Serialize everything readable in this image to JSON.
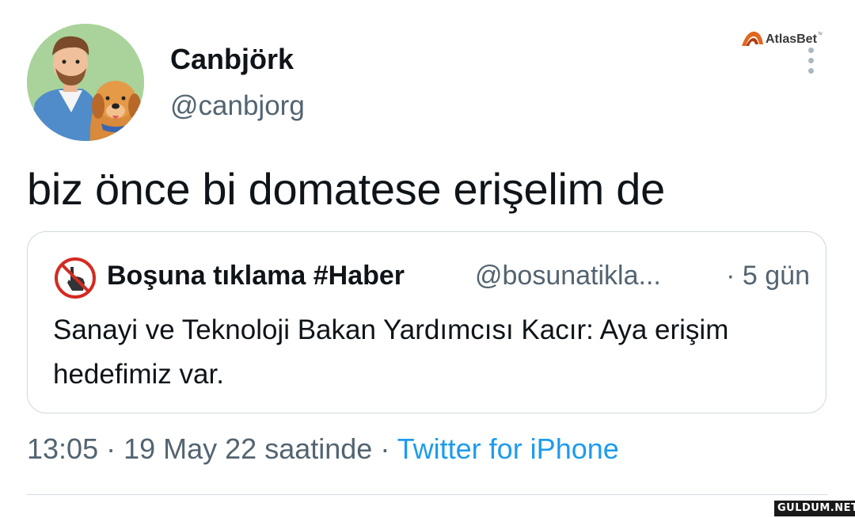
{
  "tweet": {
    "display_name": "Canbjörk",
    "handle": "@canbjorg",
    "text": "biz önce bi domatese erişelim de",
    "time": "13:05",
    "date": "19 May 22 saatinde",
    "source": "Twitter for iPhone",
    "separator": " · "
  },
  "quoted_tweet": {
    "display_name": "Boşuna tıklama #Haber",
    "handle": "@bosunatikla...",
    "age": "· 5 gün",
    "text": "Sanayi ve Teknoloji Bakan Yardımcısı Kacır: Aya erişim hedefimiz var."
  },
  "watermarks": {
    "top_brand": "AtlasBet",
    "top_brand_sup": "tv",
    "bottom_site": "GULDUM.NET"
  },
  "colors": {
    "text_primary": "#0f1419",
    "text_secondary": "#536471",
    "link": "#1d9bf0",
    "border": "#cfd9de"
  },
  "icons": {
    "avatar": "user-avatar-man-with-dog",
    "quoted_avatar": "no-click-hand-icon",
    "more": "more-vertical-icon"
  }
}
